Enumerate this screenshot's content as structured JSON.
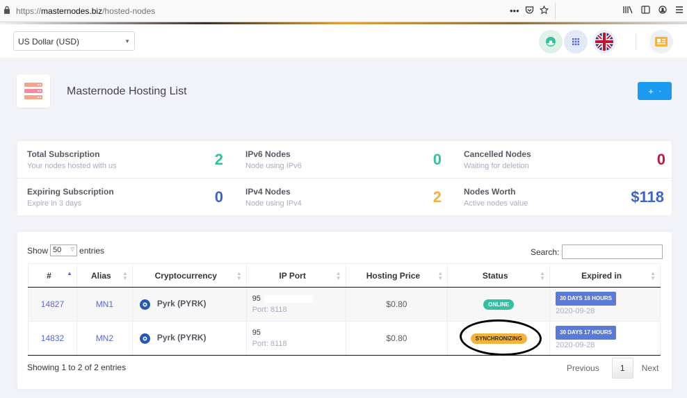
{
  "browser": {
    "url_prefix": "https://",
    "url_domain": "masternodes.biz",
    "url_path": "/hosted-nodes",
    "more_label": "•••"
  },
  "header": {
    "currency_value": "US Dollar (USD)",
    "icons": [
      "nodes-app-icon",
      "grid-icon",
      "uk-flag-icon",
      "profile-card-icon"
    ]
  },
  "page": {
    "title": "Masternode Hosting List",
    "add_button_label": "+",
    "add_button_caret": "-"
  },
  "stats": [
    {
      "title": "Total Subscription",
      "subtitle": "Your nodes hosted with us",
      "value": "2",
      "color": "#34bfa3"
    },
    {
      "title": "IPv6 Nodes",
      "subtitle": "Node using IPv6",
      "value": "0",
      "color": "#34bfa3"
    },
    {
      "title": "Cancelled Nodes",
      "subtitle": "Waiting for deletion",
      "value": "0",
      "color": "#c4183c"
    },
    {
      "title": "Expiring Subscription",
      "subtitle": "Expire in 3 days",
      "value": "0",
      "color": "#3d64c9"
    },
    {
      "title": "IPv4 Nodes",
      "subtitle": "Node using IPv4",
      "value": "2",
      "color": "#f4b33b"
    },
    {
      "title": "Nodes Worth",
      "subtitle": "Active nodes value",
      "value": "$118",
      "color": "#3d64c9"
    }
  ],
  "table": {
    "show_label": "Show",
    "entries_label": "entries",
    "page_length": "50",
    "search_label": "Search:",
    "columns": [
      "#",
      "Alias",
      "Cryptocurrency",
      "IP Port",
      "Hosting Price",
      "Status",
      "Expired in"
    ],
    "rows": [
      {
        "id": "14827",
        "alias": "MN1",
        "crypto": "Pyrk (PYRK)",
        "ip": "95",
        "port": "Port: 8118",
        "price": "$0.80",
        "status": "ONLINE",
        "expires_in": "30 DAYS 16 HOURS",
        "expires_date": "2020-09-28"
      },
      {
        "id": "14832",
        "alias": "MN2",
        "crypto": "Pyrk (PYRK)",
        "ip": "95",
        "port": "Port: 8118",
        "price": "$0.80",
        "status": "SYNCHRONIZING",
        "expires_in": "30 DAYS 17 HOURS",
        "expires_date": "2020-09-28"
      }
    ],
    "info": "Showing 1 to 2 of 2 entries",
    "prev_label": "Previous",
    "page_number": "1",
    "next_label": "Next"
  }
}
